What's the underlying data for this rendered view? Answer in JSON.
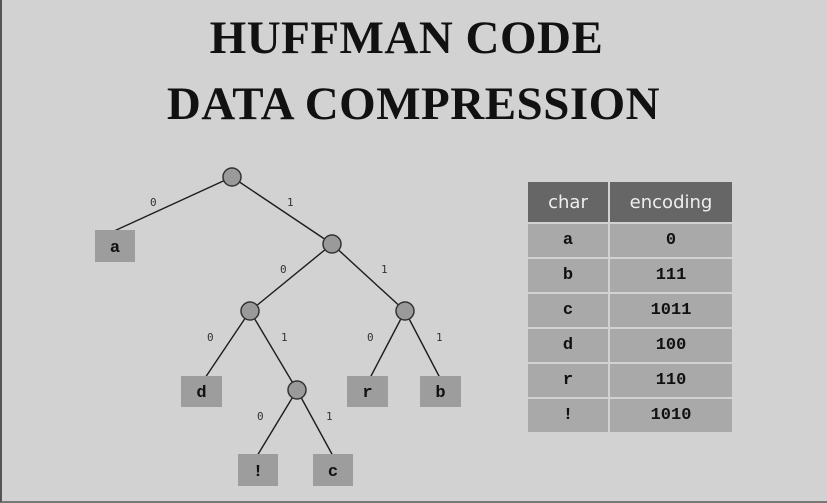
{
  "title": {
    "line1": "HUFFMAN CODE",
    "line2": "DATA COMPRESSION"
  },
  "tree": {
    "edge_bits": {
      "root_a": "0",
      "root_n1": "1",
      "n1_n2": "0",
      "n1_n3": "1",
      "n2_d": "0",
      "n2_n4": "1",
      "n3_r": "0",
      "n3_b": "1",
      "n4_excl": "0",
      "n4_c": "1"
    },
    "leaves": {
      "a": "a",
      "d": "d",
      "r": "r",
      "b": "b",
      "excl": "!",
      "c": "c"
    }
  },
  "table": {
    "headers": [
      "char",
      "encoding"
    ],
    "rows": [
      {
        "char": "a",
        "encoding": "0"
      },
      {
        "char": "b",
        "encoding": "111"
      },
      {
        "char": "c",
        "encoding": "1011"
      },
      {
        "char": "d",
        "encoding": "100"
      },
      {
        "char": "r",
        "encoding": "110"
      },
      {
        "char": "!",
        "encoding": "1010"
      }
    ]
  },
  "colors": {
    "background": "#d2d2d2",
    "header_cell": "#666666",
    "body_cell": "#a9a9a9",
    "node": "#9a9a9a"
  }
}
